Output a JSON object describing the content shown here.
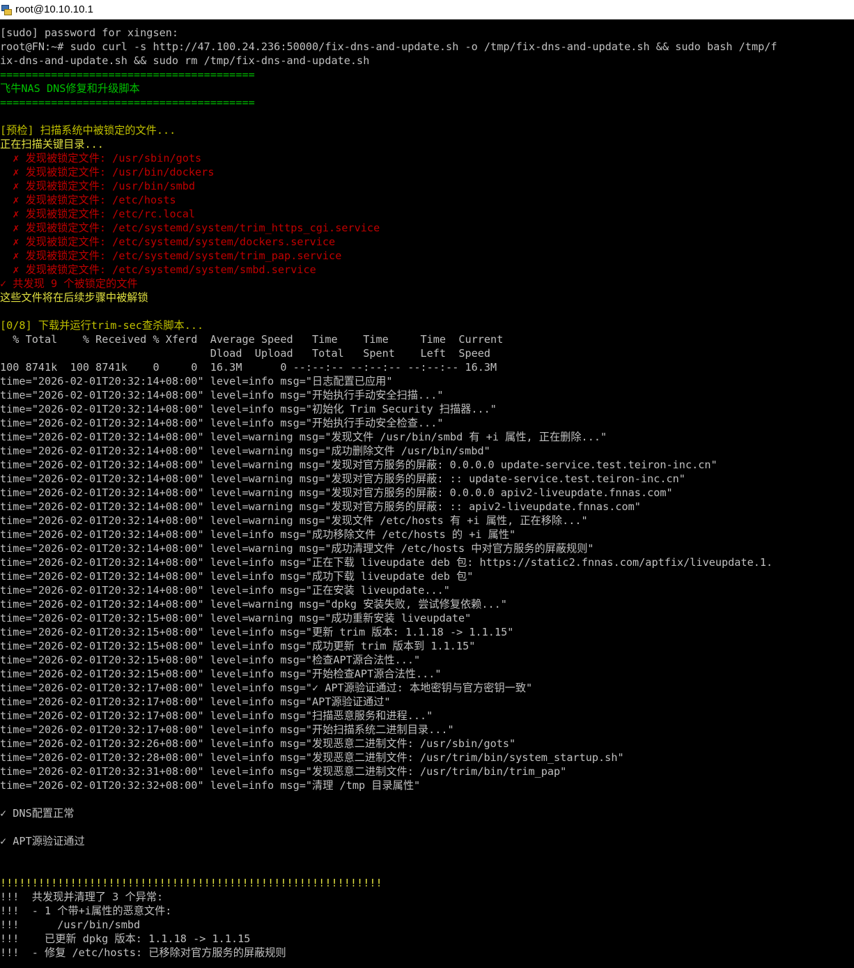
{
  "window": {
    "title": "root@10.10.10.1"
  },
  "colors": {
    "background": "#000000",
    "default_text": "#c0c0c0",
    "green": "#00c000",
    "yellow": "#c0c000",
    "red": "#c00000"
  },
  "lines": [
    {
      "c": "default",
      "t": "[sudo] password for xingsen:"
    },
    {
      "c": "default",
      "t": "root@FN:~# sudo curl -s http://47.100.24.236:50000/fix-dns-and-update.sh -o /tmp/fix-dns-and-update.sh && sudo bash /tmp/f"
    },
    {
      "c": "default",
      "t": "ix-dns-and-update.sh && sudo rm /tmp/fix-dns-and-update.sh"
    },
    {
      "c": "green",
      "t": "========================================"
    },
    {
      "c": "green",
      "t": "飞牛NAS DNS修复和升级脚本"
    },
    {
      "c": "green",
      "t": "========================================"
    },
    {
      "c": "default",
      "t": ""
    },
    {
      "c": "yellow",
      "t": "[预检] 扫描系统中被锁定的文件..."
    },
    {
      "c": "yellow2",
      "t": "正在扫描关键目录..."
    },
    {
      "c": "red",
      "t": "  ✗ 发现被锁定文件: /usr/sbin/gots"
    },
    {
      "c": "red",
      "t": "  ✗ 发现被锁定文件: /usr/bin/dockers"
    },
    {
      "c": "red",
      "t": "  ✗ 发现被锁定文件: /usr/bin/smbd"
    },
    {
      "c": "red",
      "t": "  ✗ 发现被锁定文件: /etc/hosts"
    },
    {
      "c": "red",
      "t": "  ✗ 发现被锁定文件: /etc/rc.local"
    },
    {
      "c": "red",
      "t": "  ✗ 发现被锁定文件: /etc/systemd/system/trim_https_cgi.service"
    },
    {
      "c": "red",
      "t": "  ✗ 发现被锁定文件: /etc/systemd/system/dockers.service"
    },
    {
      "c": "red",
      "t": "  ✗ 发现被锁定文件: /etc/systemd/system/trim_pap.service"
    },
    {
      "c": "red",
      "t": "  ✗ 发现被锁定文件: /etc/systemd/system/smbd.service"
    },
    {
      "c": "red",
      "t": "✓ 共发现 9 个被锁定的文件"
    },
    {
      "c": "yellow2",
      "t": "这些文件将在后续步骤中被解锁"
    },
    {
      "c": "default",
      "t": ""
    },
    {
      "c": "yellow",
      "t": "[0/8] 下载并运行trim-sec查杀脚本..."
    },
    {
      "c": "default",
      "t": "  % Total    % Received % Xferd  Average Speed   Time    Time     Time  Current"
    },
    {
      "c": "default",
      "t": "                                 Dload  Upload   Total   Spent    Left  Speed"
    },
    {
      "c": "default",
      "t": "100 8741k  100 8741k    0     0  16.3M      0 --:--:-- --:--:-- --:--:-- 16.3M"
    },
    {
      "c": "default",
      "t": "time=\"2026-02-01T20:32:14+08:00\" level=info msg=\"日志配置已应用\""
    },
    {
      "c": "default",
      "t": "time=\"2026-02-01T20:32:14+08:00\" level=info msg=\"开始执行手动安全扫描...\""
    },
    {
      "c": "default",
      "t": "time=\"2026-02-01T20:32:14+08:00\" level=info msg=\"初始化 Trim Security 扫描器...\""
    },
    {
      "c": "default",
      "t": "time=\"2026-02-01T20:32:14+08:00\" level=info msg=\"开始执行手动安全检查...\""
    },
    {
      "c": "default",
      "t": "time=\"2026-02-01T20:32:14+08:00\" level=warning msg=\"发现文件 /usr/bin/smbd 有 +i 属性, 正在删除...\""
    },
    {
      "c": "default",
      "t": "time=\"2026-02-01T20:32:14+08:00\" level=warning msg=\"成功删除文件 /usr/bin/smbd\""
    },
    {
      "c": "default",
      "t": "time=\"2026-02-01T20:32:14+08:00\" level=warning msg=\"发现对官方服务的屏蔽: 0.0.0.0 update-service.test.teiron-inc.cn\""
    },
    {
      "c": "default",
      "t": "time=\"2026-02-01T20:32:14+08:00\" level=warning msg=\"发现对官方服务的屏蔽: :: update-service.test.teiron-inc.cn\""
    },
    {
      "c": "default",
      "t": "time=\"2026-02-01T20:32:14+08:00\" level=warning msg=\"发现对官方服务的屏蔽: 0.0.0.0 apiv2-liveupdate.fnnas.com\""
    },
    {
      "c": "default",
      "t": "time=\"2026-02-01T20:32:14+08:00\" level=warning msg=\"发现对官方服务的屏蔽: :: apiv2-liveupdate.fnnas.com\""
    },
    {
      "c": "default",
      "t": "time=\"2026-02-01T20:32:14+08:00\" level=warning msg=\"发现文件 /etc/hosts 有 +i 属性, 正在移除...\""
    },
    {
      "c": "default",
      "t": "time=\"2026-02-01T20:32:14+08:00\" level=info msg=\"成功移除文件 /etc/hosts 的 +i 属性\""
    },
    {
      "c": "default",
      "t": "time=\"2026-02-01T20:32:14+08:00\" level=warning msg=\"成功清理文件 /etc/hosts 中对官方服务的屏蔽规则\""
    },
    {
      "c": "default",
      "t": "time=\"2026-02-01T20:32:14+08:00\" level=info msg=\"正在下载 liveupdate deb 包: https://static2.fnnas.com/aptfix/liveupdate.1."
    },
    {
      "c": "default",
      "t": "time=\"2026-02-01T20:32:14+08:00\" level=info msg=\"成功下载 liveupdate deb 包\""
    },
    {
      "c": "default",
      "t": "time=\"2026-02-01T20:32:14+08:00\" level=info msg=\"正在安装 liveupdate...\""
    },
    {
      "c": "default",
      "t": "time=\"2026-02-01T20:32:14+08:00\" level=warning msg=\"dpkg 安装失败, 尝试修复依赖...\""
    },
    {
      "c": "default",
      "t": "time=\"2026-02-01T20:32:15+08:00\" level=warning msg=\"成功重新安装 liveupdate\""
    },
    {
      "c": "default",
      "t": "time=\"2026-02-01T20:32:15+08:00\" level=info msg=\"更新 trim 版本: 1.1.18 -> 1.1.15\""
    },
    {
      "c": "default",
      "t": "time=\"2026-02-01T20:32:15+08:00\" level=info msg=\"成功更新 trim 版本到 1.1.15\""
    },
    {
      "c": "default",
      "t": "time=\"2026-02-01T20:32:15+08:00\" level=info msg=\"检查APT源合法性...\""
    },
    {
      "c": "default",
      "t": "time=\"2026-02-01T20:32:15+08:00\" level=info msg=\"开始检查APT源合法性...\""
    },
    {
      "c": "default",
      "t": "time=\"2026-02-01T20:32:17+08:00\" level=info msg=\"✓ APT源验证通过: 本地密钥与官方密钥一致\""
    },
    {
      "c": "default",
      "t": "time=\"2026-02-01T20:32:17+08:00\" level=info msg=\"APT源验证通过\""
    },
    {
      "c": "default",
      "t": "time=\"2026-02-01T20:32:17+08:00\" level=info msg=\"扫描恶意服务和进程...\""
    },
    {
      "c": "default",
      "t": "time=\"2026-02-01T20:32:17+08:00\" level=info msg=\"开始扫描系统二进制目录...\""
    },
    {
      "c": "default",
      "t": "time=\"2026-02-01T20:32:26+08:00\" level=info msg=\"发现恶意二进制文件: /usr/sbin/gots\""
    },
    {
      "c": "default",
      "t": "time=\"2026-02-01T20:32:28+08:00\" level=info msg=\"发现恶意二进制文件: /usr/trim/bin/system_startup.sh\""
    },
    {
      "c": "default",
      "t": "time=\"2026-02-01T20:32:31+08:00\" level=info msg=\"发现恶意二进制文件: /usr/trim/bin/trim_pap\""
    },
    {
      "c": "default",
      "t": "time=\"2026-02-01T20:32:32+08:00\" level=info msg=\"清理 /tmp 目录属性\""
    },
    {
      "c": "default",
      "t": ""
    },
    {
      "c": "default",
      "t": "✓ DNS配置正常"
    },
    {
      "c": "default",
      "t": ""
    },
    {
      "c": "default",
      "t": "✓ APT源验证通过"
    },
    {
      "c": "default",
      "t": ""
    },
    {
      "c": "default",
      "t": ""
    },
    {
      "c": "yellow2",
      "t": "!!!!!!!!!!!!!!!!!!!!!!!!!!!!!!!!!!!!!!!!!!!!!!!!!!!!!!!!!!!!"
    },
    {
      "c": "default",
      "t": "!!!  共发现并清理了 3 个异常:"
    },
    {
      "c": "default",
      "t": "!!!  - 1 个带+i属性的恶意文件:"
    },
    {
      "c": "default",
      "t": "!!!      /usr/bin/smbd"
    },
    {
      "c": "default",
      "t": "!!!    已更新 dpkg 版本: 1.1.18 -> 1.1.15"
    },
    {
      "c": "default",
      "t": "!!!  - 修复 /etc/hosts: 已移除对官方服务的屏蔽规则"
    }
  ]
}
